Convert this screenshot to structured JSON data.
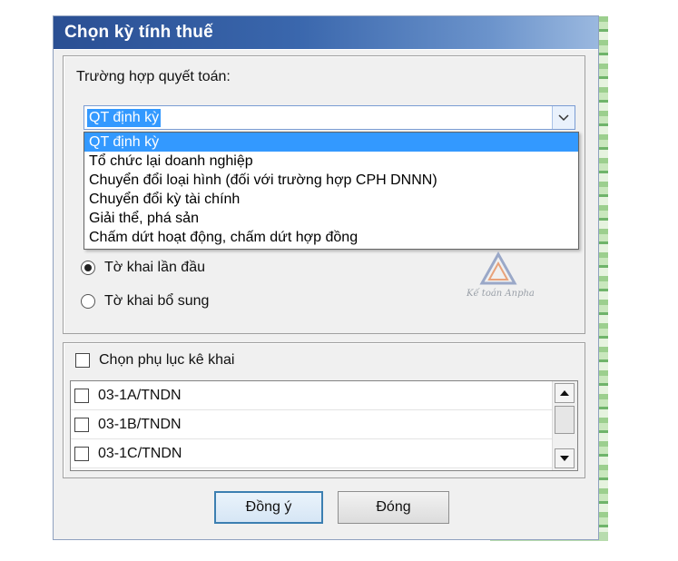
{
  "window": {
    "title": "Chọn kỳ tính thuế"
  },
  "settlement": {
    "label": "Trường hợp quyết toán:",
    "selected": "QT định kỳ",
    "options": [
      "QT định kỳ",
      "Tổ chức lại doanh nghiệp",
      "Chuyển đổi loại hình (đối với trường hợp CPH DNNN)",
      "Chuyển đổi kỳ tài chính",
      "Giải thể, phá sản",
      "Chấm dứt hoạt động, chấm dứt hợp đồng"
    ]
  },
  "declaration_type": {
    "options": [
      {
        "label": "Tờ khai lần đầu",
        "checked": true
      },
      {
        "label": "Tờ khai bổ sung",
        "checked": false
      }
    ]
  },
  "appendix": {
    "label": "Chọn phụ lục kê khai",
    "checked": false,
    "items": [
      {
        "label": "03-1A/TNDN",
        "checked": false
      },
      {
        "label": "03-1B/TNDN",
        "checked": false
      },
      {
        "label": "03-1C/TNDN",
        "checked": false
      }
    ]
  },
  "buttons": {
    "ok": "Đồng ý",
    "close": "Đóng"
  },
  "watermark": {
    "text": "Kế toán Anpha"
  },
  "colors": {
    "accent": "#3399ff",
    "titlebar": "#2a4f93"
  }
}
